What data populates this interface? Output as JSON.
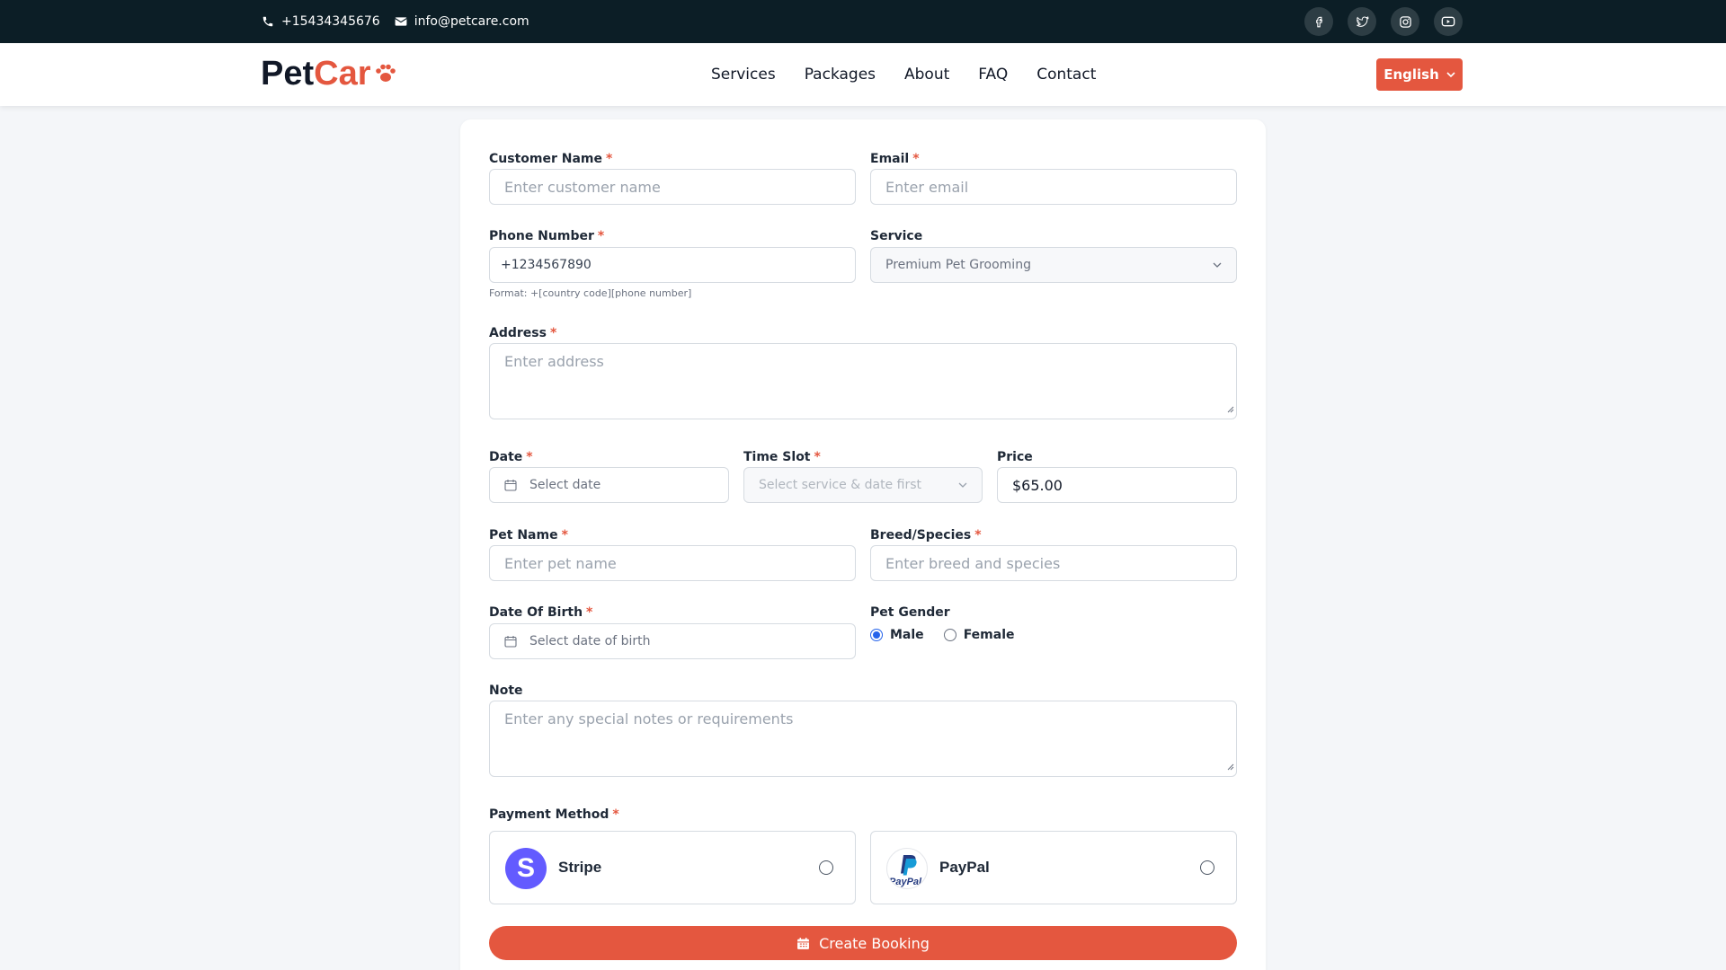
{
  "topbar": {
    "phone": "+15434345676",
    "email": "info@petcare.com",
    "socials": [
      "facebook-icon",
      "twitter-icon",
      "instagram-icon",
      "youtube-icon"
    ]
  },
  "nav": {
    "logo_dark": "Pet",
    "logo_red": "Car",
    "items": [
      "Services",
      "Packages",
      "About",
      "FAQ",
      "Contact"
    ],
    "language": "English"
  },
  "form": {
    "customer_name": {
      "label": "Customer Name",
      "placeholder": "Enter customer name"
    },
    "email": {
      "label": "Email",
      "placeholder": "Enter email"
    },
    "phone": {
      "label": "Phone Number",
      "value": "+1234567890",
      "hint": "Format: +[country code][phone number]"
    },
    "service": {
      "label": "Service",
      "value": "Premium Pet Grooming"
    },
    "address": {
      "label": "Address",
      "placeholder": "Enter address"
    },
    "date": {
      "label": "Date",
      "placeholder": "Select date"
    },
    "time_slot": {
      "label": "Time Slot",
      "placeholder": "Select service & date first"
    },
    "price": {
      "label": "Price",
      "value": "$65.00"
    },
    "pet_name": {
      "label": "Pet Name",
      "placeholder": "Enter pet name"
    },
    "breed": {
      "label": "Breed/Species",
      "placeholder": "Enter breed and species"
    },
    "dob": {
      "label": "Date Of Birth",
      "placeholder": "Select date of birth"
    },
    "gender": {
      "label": "Pet Gender",
      "options": [
        "Male",
        "Female"
      ],
      "selected": "Male"
    },
    "note": {
      "label": "Note",
      "placeholder": "Enter any special notes or requirements"
    },
    "payment": {
      "label": "Payment Method",
      "options": [
        {
          "name": "Stripe",
          "logo": "S"
        },
        {
          "name": "PayPal",
          "logo": "PayPal"
        }
      ]
    },
    "submit_label": "Create Booking"
  },
  "colors": {
    "accent": "#e4573f",
    "topbar_bg": "#0c1e26",
    "stripe": "#635bff",
    "radio_selected": "#2563eb"
  }
}
